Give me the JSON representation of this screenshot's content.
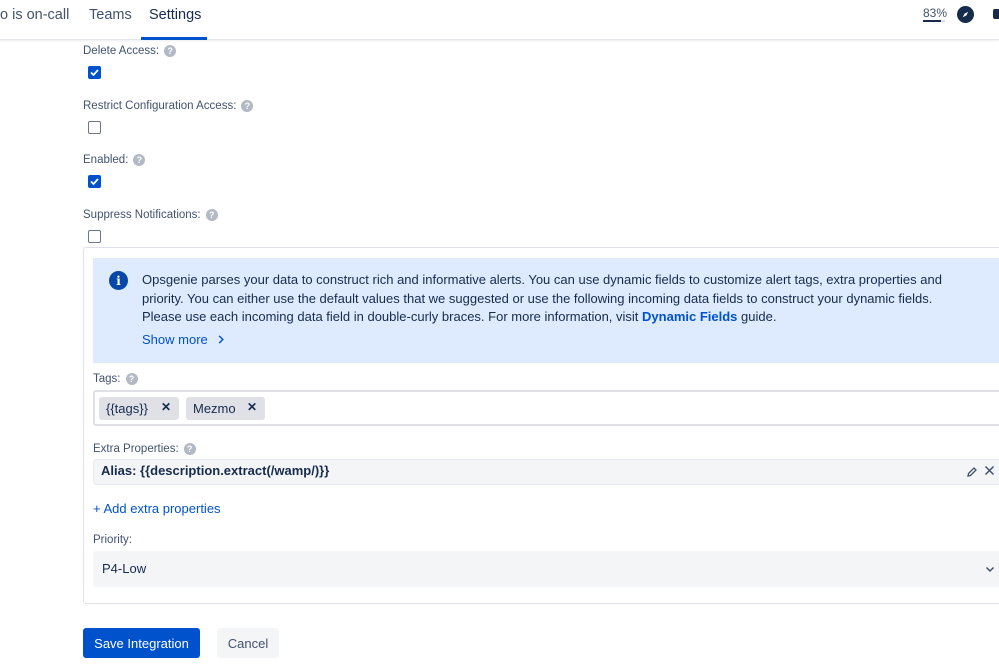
{
  "nav": {
    "items": [
      {
        "label": "o is on-call"
      },
      {
        "label": "Teams"
      },
      {
        "label": "Settings"
      }
    ],
    "zoom": "83%"
  },
  "fields": {
    "delete_access": {
      "label": "Delete Access:",
      "checked": true
    },
    "restrict_config": {
      "label": "Restrict Configuration Access:",
      "checked": false
    },
    "enabled": {
      "label": "Enabled:",
      "checked": true
    },
    "suppress": {
      "label": "Suppress Notifications:",
      "checked": false
    }
  },
  "info": {
    "text_before": "Opsgenie parses your data to construct rich and informative alerts. You can use dynamic fields to customize alert tags, extra properties and priority. You can either use the default values that we suggested or use the following incoming data fields to construct your dynamic fields. Please use each incoming data field in double-curly braces. For more information, visit ",
    "link": "Dynamic Fields",
    "text_after": " guide.",
    "show_more": "Show more"
  },
  "tags": {
    "label": "Tags:",
    "items": [
      "{{tags}}",
      "Mezmo"
    ]
  },
  "extra_properties": {
    "label": "Extra Properties:",
    "items": [
      "Alias: {{description.extract(/wamp/)}}"
    ],
    "add_label": "+ Add extra properties"
  },
  "priority": {
    "label": "Priority:",
    "value": "P4-Low"
  },
  "actions": {
    "save": "Save Integration",
    "cancel": "Cancel"
  },
  "colors": {
    "primary": "#0052cc",
    "info_bg": "#deebff",
    "text": "#172b4d"
  }
}
